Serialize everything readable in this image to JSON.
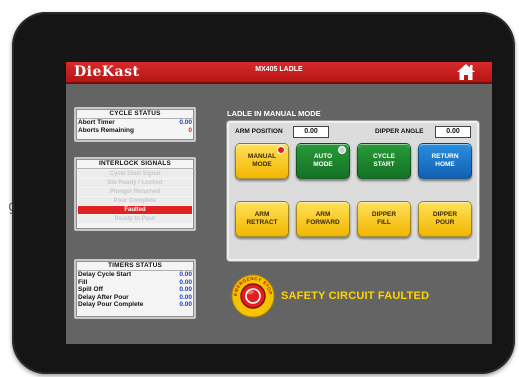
{
  "background": {
    "fragment_text": "g"
  },
  "header": {
    "logo": "DieKast",
    "model": "MX405 LADLE",
    "home_icon": "home-icon"
  },
  "cycle_status": {
    "title": "CYCLE STATUS",
    "rows": [
      {
        "label": "Abort Timer",
        "value": "0.00"
      },
      {
        "label": "Aborts Remaining",
        "value": "0"
      }
    ]
  },
  "interlock": {
    "title": "INTERLOCK SIGNALS",
    "items": [
      "Cycle Start Signal",
      "Die Ready / Locked",
      "Plunger Returned",
      "Pour Complete",
      "Faulted",
      "Ready to Pour"
    ],
    "active_index": 4
  },
  "timers": {
    "title": "TIMERS STATUS",
    "rows": [
      {
        "label": "Delay Cycle Start",
        "value": "0.00"
      },
      {
        "label": "Fill",
        "value": "0.00"
      },
      {
        "label": "Spill Off",
        "value": "0.00"
      },
      {
        "label": "Delay After Pour",
        "value": "0.00"
      },
      {
        "label": "Delay Pour Complete",
        "value": "0.00"
      }
    ]
  },
  "ladle": {
    "title": "LADLE IN MANUAL MODE",
    "arm_position_label": "ARM POSITION",
    "arm_position_value": "0.00",
    "dipper_angle_label": "DIPPER ANGLE",
    "dipper_angle_value": "0.00",
    "buttons": [
      {
        "label": "MANUAL MODE",
        "color": "#f2c200"
      },
      {
        "label": "AUTO MODE",
        "color": "#1a8a2e"
      },
      {
        "label": "CYCLE START",
        "color": "#1a8a2e"
      },
      {
        "label": "RETURN HOME",
        "color": "#1a72c8"
      },
      {
        "label": "ARM RETRACT",
        "color": "#f2c200"
      },
      {
        "label": "ARM FORWARD",
        "color": "#f2c200"
      },
      {
        "label": "DIPPER FILL",
        "color": "#f2c200"
      },
      {
        "label": "DIPPER POUR",
        "color": "#f2c200"
      }
    ]
  },
  "safety": {
    "estop_label": "EMERGENCY STOP",
    "message": "SAFETY CIRCUIT FAULTED",
    "colors": {
      "fault_text": "#ffd400",
      "estop": "#e01f1f",
      "estop_ring": "#f5c400"
    }
  }
}
